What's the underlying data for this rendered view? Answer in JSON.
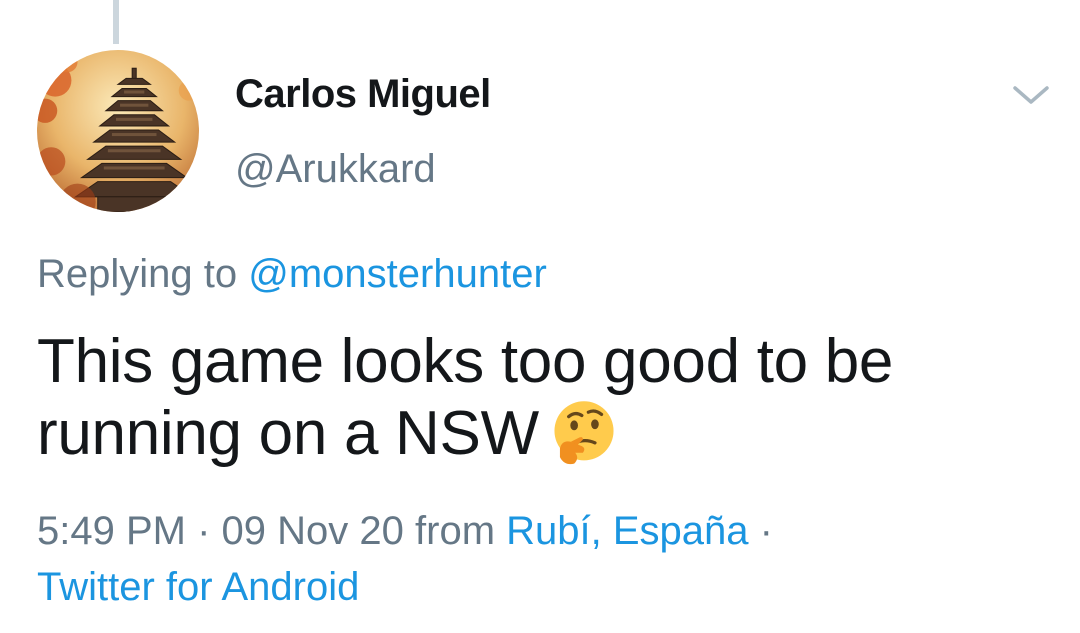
{
  "tweet": {
    "display_name": "Carlos Miguel",
    "handle": "@Arukkard",
    "avatar_icon": "pagoda-avatar",
    "menu_icon": "chevron-down-icon",
    "replying_prefix": "Replying to",
    "replying_to": "@monsterhunter",
    "text_line1": "This game looks too good to be",
    "text_line2": "running on a NSW",
    "emoji": "thinking-face",
    "time": "5:49 PM",
    "separator": "·",
    "date": "09 Nov 20",
    "from_word": "from",
    "location": "Rubí, España",
    "client": "Twitter for Android"
  },
  "colors": {
    "text": "#14171a",
    "secondary": "#657786",
    "link": "#1b95e0",
    "thread_line": "#ccd6dd"
  }
}
